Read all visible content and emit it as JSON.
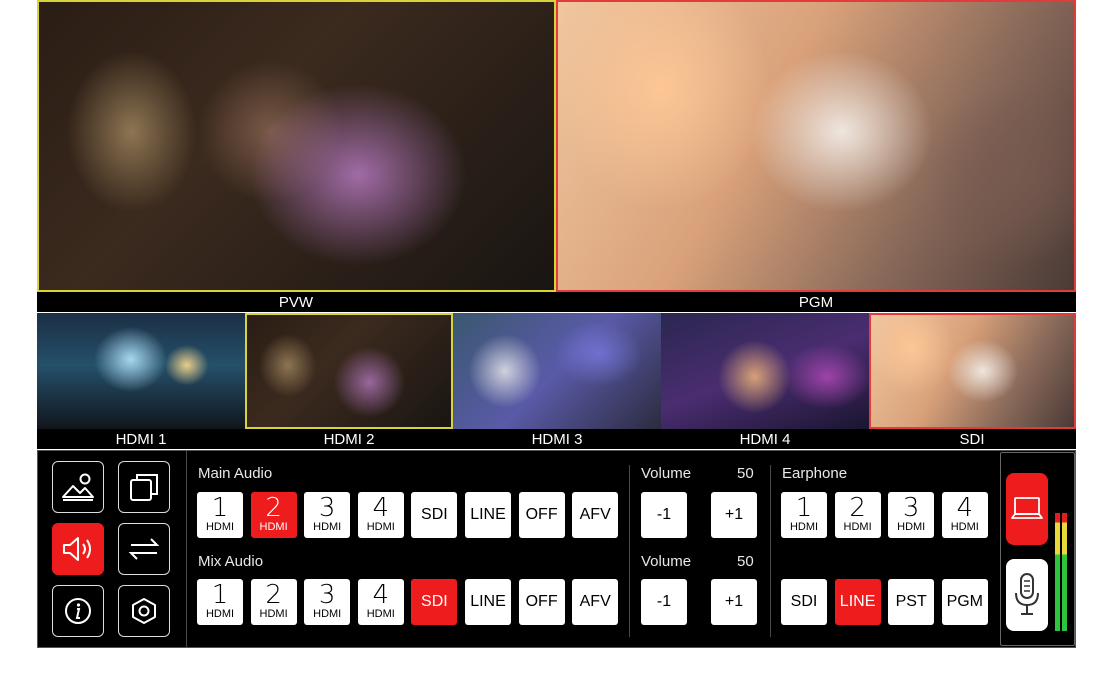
{
  "viewers": {
    "pvw": {
      "label": "PVW",
      "border_color": "#d9d33a"
    },
    "pgm": {
      "label": "PGM",
      "border_color": "#e23b3b"
    }
  },
  "sources": [
    {
      "label": "HDMI 1"
    },
    {
      "label": "HDMI 2"
    },
    {
      "label": "HDMI 3"
    },
    {
      "label": "HDMI 4"
    },
    {
      "label": "SDI"
    }
  ],
  "sidebar": {
    "icons": [
      {
        "name": "image-icon",
        "active": false
      },
      {
        "name": "layers-icon",
        "active": false
      },
      {
        "name": "speaker-icon",
        "active": true
      },
      {
        "name": "transition-arrows-icon",
        "active": false
      },
      {
        "name": "info-icon",
        "active": false
      },
      {
        "name": "settings-hexagon-icon",
        "active": false
      }
    ]
  },
  "main_audio": {
    "title": "Main Audio",
    "keys": [
      {
        "big": "1",
        "small": "HDMI",
        "active": false
      },
      {
        "big": "2",
        "small": "HDMI",
        "active": true
      },
      {
        "big": "3",
        "small": "HDMI",
        "active": false
      },
      {
        "big": "4",
        "small": "HDMI",
        "active": false
      },
      {
        "word": "SDI",
        "active": false
      },
      {
        "word": "LINE",
        "active": false
      },
      {
        "word": "OFF",
        "active": false
      },
      {
        "word": "AFV",
        "active": false
      }
    ],
    "volume_label": "Volume",
    "volume_value": "50",
    "minus_label": "-1",
    "plus_label": "+1"
  },
  "mix_audio": {
    "title": "Mix Audio",
    "keys": [
      {
        "big": "1",
        "small": "HDMI",
        "active": false
      },
      {
        "big": "2",
        "small": "HDMI",
        "active": false
      },
      {
        "big": "3",
        "small": "HDMI",
        "active": false
      },
      {
        "big": "4",
        "small": "HDMI",
        "active": false
      },
      {
        "word": "SDI",
        "active": true
      },
      {
        "word": "LINE",
        "active": false
      },
      {
        "word": "OFF",
        "active": false
      },
      {
        "word": "AFV",
        "active": false
      }
    ],
    "volume_label": "Volume",
    "volume_value": "50",
    "minus_label": "-1",
    "plus_label": "+1"
  },
  "earphone": {
    "title": "Earphone",
    "keys_top": [
      {
        "big": "1",
        "small": "HDMI",
        "active": false
      },
      {
        "big": "2",
        "small": "HDMI",
        "active": false
      },
      {
        "big": "3",
        "small": "HDMI",
        "active": false
      },
      {
        "big": "4",
        "small": "HDMI",
        "active": false
      }
    ],
    "keys_bottom": [
      {
        "word": "SDI",
        "active": false
      },
      {
        "word": "LINE",
        "active": true
      },
      {
        "word": "PST",
        "active": false
      },
      {
        "word": "PGM",
        "active": false
      }
    ]
  },
  "colors": {
    "active_red": "#ee1c1c",
    "meter_green": "#2dc63a",
    "meter_yellow": "#e8d83a",
    "meter_red": "#e02020"
  }
}
